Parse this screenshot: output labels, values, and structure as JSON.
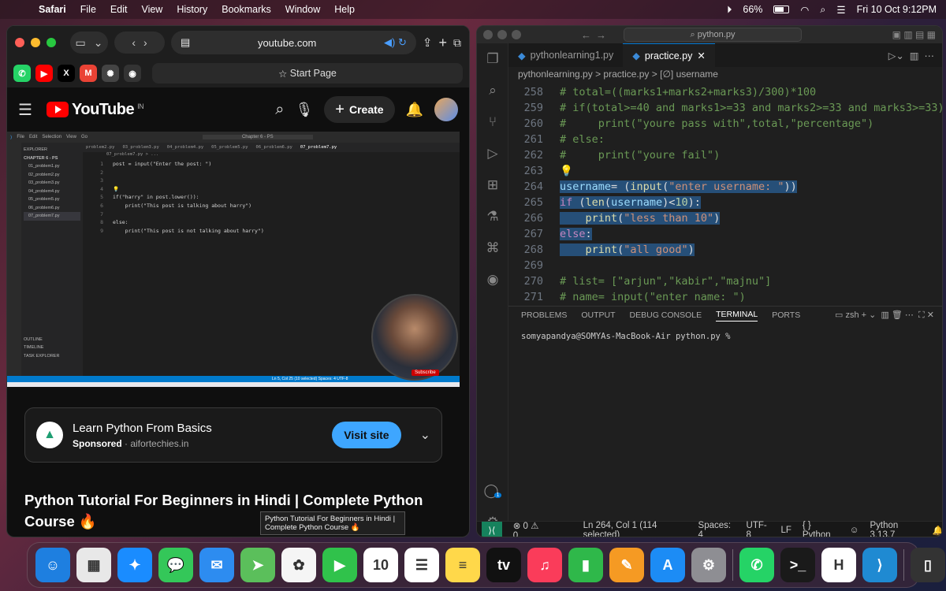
{
  "menubar": {
    "app": "Safari",
    "items": [
      "File",
      "Edit",
      "View",
      "History",
      "Bookmarks",
      "Window",
      "Help"
    ],
    "battery": "66%",
    "battery_level": 0.66,
    "datetime": "Fri 10 Oct  9:12PM"
  },
  "safari": {
    "url": "youtube.com",
    "start_page": "Start Page",
    "favorites": [
      {
        "icon": "whatsapp-icon",
        "glyph": "✆",
        "color": "#25d366"
      },
      {
        "icon": "youtube-icon",
        "glyph": "▶",
        "color": "#ff0000"
      },
      {
        "icon": "x-icon",
        "glyph": "X",
        "color": "#000000"
      },
      {
        "icon": "gmail-icon",
        "glyph": "M",
        "color": "#ea4335"
      },
      {
        "icon": "chatgpt-icon",
        "glyph": "✺",
        "color": "#444444"
      },
      {
        "icon": "github-icon",
        "glyph": "◉",
        "color": "#333333"
      }
    ]
  },
  "youtube": {
    "logo": "YouTube",
    "region": "IN",
    "create_label": "Create",
    "ad": {
      "title": "Learn Python From Basics",
      "sponsored": "Sponsored",
      "domain": "aifortechies.in",
      "cta": "Visit site"
    },
    "video_title": "Python Tutorial For Beginners in Hindi | Complete Python Course 🔥",
    "tooltip": "Python Tutorial For Beginners in Hindi | Complete Python Course 🔥",
    "embedded": {
      "title_search": "Chapter 6 - PS",
      "menu": [
        "File",
        "Edit",
        "Selection",
        "View",
        "Go"
      ],
      "explorer_title": "EXPLORER",
      "folder": "CHAPTER 6 - PS",
      "files": [
        "01_problem1.py",
        "02_problem2.py",
        "03_problem3.py",
        "04_problem4.py",
        "05_problem5.py",
        "06_problem6.py",
        "07_problem7.py"
      ],
      "sections": [
        "OUTLINE",
        "TIMELINE",
        "TASK EXPLORER"
      ],
      "tabs": [
        "problem2.py",
        "03_problem3.py",
        "04_problem4.py",
        "05_problem5.py",
        "06_problem6.py",
        "07_problem7.py"
      ],
      "crumb": "07_problem7.py > ...",
      "code": [
        {
          "n": "1",
          "t": "post = input(\"Enter the post: \")"
        },
        {
          "n": "2",
          "t": ""
        },
        {
          "n": "3",
          "t": ""
        },
        {
          "n": "4",
          "t": "💡"
        },
        {
          "n": "5",
          "t": "if(\"harry\" in post.lower()):"
        },
        {
          "n": "6",
          "t": "    print(\"This post is talking about harry\")"
        },
        {
          "n": "7",
          "t": ""
        },
        {
          "n": "8",
          "t": "else:"
        },
        {
          "n": "9",
          "t": "    print(\"This post is not talking about harry\")"
        }
      ],
      "status": "Ln 5, Col 25 (10 selected)   Spaces: 4   UTF-8",
      "subscribe": "Subscribe"
    }
  },
  "vscode": {
    "search": "python.py",
    "tabs": [
      {
        "label": "pythonlearning1.py",
        "active": false
      },
      {
        "label": "practice.py",
        "active": true
      }
    ],
    "breadcrumb": "pythonlearning.py  >  practice.py  >  [∅] username",
    "lines": [
      {
        "n": "258",
        "html": "<span class='cm'># total=((marks1+marks2+marks3)/300)*100</span>"
      },
      {
        "n": "259",
        "html": "<span class='cm'># if(total&gt;=40 and marks1&gt;=33 and marks2&gt;=33 and marks3&gt;=33)</span>"
      },
      {
        "n": "260",
        "html": "<span class='cm'>#     print(\"youre pass with\",total,\"percentage\")</span>"
      },
      {
        "n": "261",
        "html": "<span class='cm'># else:</span>"
      },
      {
        "n": "262",
        "html": "<span class='cm'>#     print(\"youre fail\")</span>"
      },
      {
        "n": "263",
        "html": "💡"
      },
      {
        "n": "264",
        "html": "<span class='sel'><span class='var'>username</span>= (<span class='fn'>input</span>(<span class='str'>\"enter username: \"</span>))</span>"
      },
      {
        "n": "265",
        "html": "<span class='sel'><span class='kw'>if</span> (<span class='fn'>len</span>(<span class='var'>username</span>)&lt;<span class='num'>10</span>):</span>"
      },
      {
        "n": "266",
        "html": "<span class='sel'>    <span class='fn'>print</span>(<span class='str'>\"less than 10\"</span>)</span>"
      },
      {
        "n": "267",
        "html": "<span class='sel'><span class='kw'>else</span>:</span>"
      },
      {
        "n": "268",
        "html": "<span class='sel'>    <span class='fn'>print</span>(<span class='str'>\"all good\"</span>)</span>"
      },
      {
        "n": "269",
        "html": ""
      },
      {
        "n": "270",
        "html": "<span class='cm'># list= [\"arjun\",\"kabir\",\"majnu\"]</span>"
      },
      {
        "n": "271",
        "html": "<span class='cm'># name= input(\"enter name: \")</span>"
      }
    ],
    "panel_tabs": [
      "PROBLEMS",
      "OUTPUT",
      "DEBUG CONSOLE",
      "TERMINAL",
      "PORTS"
    ],
    "active_panel": "TERMINAL",
    "shell": "zsh",
    "terminal_line": "somyapandya@SOMYAs-MacBook-Air python.py %",
    "status": {
      "problems": "⊗ 0 ⚠ 0",
      "position": "Ln 264, Col 1 (114 selected)",
      "spaces": "Spaces: 4",
      "encoding": "UTF-8",
      "eol": "LF",
      "language": "{ } Python",
      "interpreter": "Python 3.13.7"
    },
    "accounts_badge": "1"
  },
  "dock": [
    {
      "name": "finder-icon",
      "glyph": "☺",
      "color": "#1e7fe0"
    },
    {
      "name": "launchpad-icon",
      "glyph": "▦",
      "color": "#e8e8e8"
    },
    {
      "name": "safari-icon",
      "glyph": "✦",
      "color": "#1a8cff"
    },
    {
      "name": "messages-icon",
      "glyph": "💬",
      "color": "#34c759"
    },
    {
      "name": "mail-icon",
      "glyph": "✉",
      "color": "#2d8cf0"
    },
    {
      "name": "maps-icon",
      "glyph": "➤",
      "color": "#5bbf5b"
    },
    {
      "name": "photos-icon",
      "glyph": "✿",
      "color": "#f5f5f5"
    },
    {
      "name": "facetime-icon",
      "glyph": "▶",
      "color": "#30c24b"
    },
    {
      "name": "calendar-icon",
      "glyph": "10",
      "color": "#ffffff"
    },
    {
      "name": "reminders-icon",
      "glyph": "☰",
      "color": "#ffffff"
    },
    {
      "name": "notes-icon",
      "glyph": "≡",
      "color": "#ffd84a"
    },
    {
      "name": "tv-icon",
      "glyph": "tv",
      "color": "#111111"
    },
    {
      "name": "music-icon",
      "glyph": "♫",
      "color": "#fa3c5a"
    },
    {
      "name": "numbers-icon",
      "glyph": "▮",
      "color": "#2fb84a"
    },
    {
      "name": "pages-icon",
      "glyph": "✎",
      "color": "#f59a23"
    },
    {
      "name": "appstore-icon",
      "glyph": "A",
      "color": "#1c8cf5"
    },
    {
      "name": "settings-icon",
      "glyph": "⚙",
      "color": "#8e8e93"
    },
    {
      "name": "whatsapp-icon",
      "glyph": "✆",
      "color": "#25d366"
    },
    {
      "name": "terminal-icon",
      "glyph": ">_",
      "color": "#1a1a1a"
    },
    {
      "name": "hyper-icon",
      "glyph": "H",
      "color": "#ffffff"
    },
    {
      "name": "vscode-icon",
      "glyph": "⟩",
      "color": "#1f8ad2"
    },
    {
      "name": "document-icon",
      "glyph": "▯",
      "color": "#333333"
    },
    {
      "name": "trash-icon",
      "glyph": "🗑",
      "color": "#9a9a9a"
    }
  ]
}
